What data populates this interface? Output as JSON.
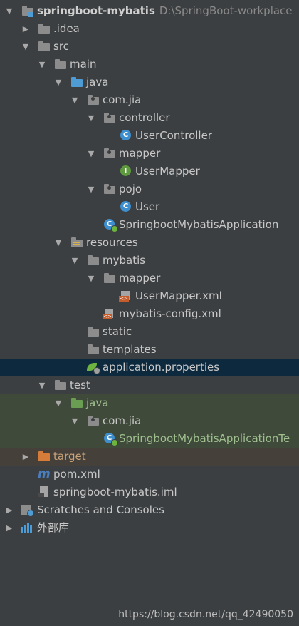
{
  "project": {
    "name": "springboot-mybatis",
    "path": "D:\\SpringBoot-workplace"
  },
  "tree": [
    {
      "label": "springboot-mybatis",
      "level": 0,
      "icon": "module-folder-icon",
      "arrow": "down",
      "bold": true
    },
    {
      "label": ".idea",
      "level": 1,
      "icon": "folder-icon",
      "arrow": "right"
    },
    {
      "label": "src",
      "level": 1,
      "icon": "folder-icon",
      "arrow": "down"
    },
    {
      "label": "main",
      "level": 2,
      "icon": "folder-icon",
      "arrow": "down"
    },
    {
      "label": "java",
      "level": 3,
      "icon": "source-folder-icon",
      "arrow": "down"
    },
    {
      "label": "com.jia",
      "level": 4,
      "icon": "package-icon",
      "arrow": "down"
    },
    {
      "label": "controller",
      "level": 5,
      "icon": "package-icon",
      "arrow": "down"
    },
    {
      "label": "UserController",
      "level": 6,
      "icon": "class-icon"
    },
    {
      "label": "mapper",
      "level": 5,
      "icon": "package-icon",
      "arrow": "down"
    },
    {
      "label": "UserMapper",
      "level": 6,
      "icon": "interface-icon"
    },
    {
      "label": "pojo",
      "level": 5,
      "icon": "package-icon",
      "arrow": "down"
    },
    {
      "label": "User",
      "level": 6,
      "icon": "class-icon"
    },
    {
      "label": "SpringbootMybatisApplication",
      "level": 5,
      "icon": "spring-boot-class-icon"
    },
    {
      "label": "resources",
      "level": 3,
      "icon": "resources-folder-icon",
      "arrow": "down"
    },
    {
      "label": "mybatis",
      "level": 4,
      "icon": "folder-icon",
      "arrow": "down"
    },
    {
      "label": "mapper",
      "level": 5,
      "icon": "folder-icon",
      "arrow": "down"
    },
    {
      "label": "UserMapper.xml",
      "level": 6,
      "icon": "xml-file-icon"
    },
    {
      "label": "mybatis-config.xml",
      "level": 5,
      "icon": "xml-file-icon"
    },
    {
      "label": "static",
      "level": 4,
      "icon": "folder-icon"
    },
    {
      "label": "templates",
      "level": 4,
      "icon": "folder-icon"
    },
    {
      "label": "application.properties",
      "level": 4,
      "icon": "spring-properties-icon",
      "selected": true
    },
    {
      "label": "test",
      "level": 2,
      "icon": "folder-icon",
      "arrow": "down"
    },
    {
      "label": "java",
      "level": 3,
      "icon": "test-source-folder-icon",
      "arrow": "down",
      "test": true
    },
    {
      "label": "com.jia",
      "level": 4,
      "icon": "package-icon",
      "arrow": "down",
      "test": true
    },
    {
      "label": "SpringbootMybatisApplicationTe",
      "level": 5,
      "icon": "spring-boot-test-class-icon",
      "test": true
    },
    {
      "label": "target",
      "level": 1,
      "icon": "excluded-folder-icon",
      "arrow": "right",
      "target": true
    },
    {
      "label": "pom.xml",
      "level": 1,
      "icon": "maven-icon"
    },
    {
      "label": "springboot-mybatis.iml",
      "level": 1,
      "icon": "iml-file-icon"
    },
    {
      "label": "Scratches and Consoles",
      "level": 0,
      "icon": "scratches-icon",
      "arrow": "right"
    },
    {
      "label": "外部库",
      "level": 0,
      "icon": "external-libraries-icon",
      "arrow": "right"
    }
  ],
  "watermark": "https://blog.csdn.net/qq_42490050",
  "colors": {
    "background": "#3c3f41",
    "selection": "#0d293e",
    "folder": "#8c8c8c",
    "source_folder": "#4f9bd3",
    "test_source_folder": "#6a9e52",
    "excluded_folder": "#d67c3a",
    "class_circle": "#3e8fcf",
    "interface_circle": "#5e9b3e",
    "xml_tag": "#c55c2c",
    "maven": "#4a7fbf"
  }
}
